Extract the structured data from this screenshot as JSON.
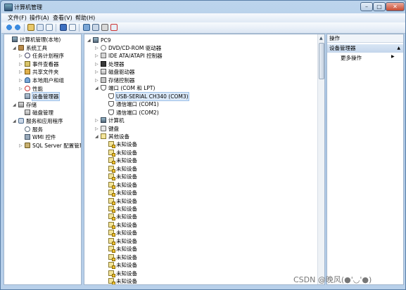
{
  "window": {
    "title": "计算机管理"
  },
  "menu": [
    "文件(F)",
    "操作(A)",
    "查看(V)",
    "帮助(H)"
  ],
  "left_tree": [
    {
      "label": "计算机管理(本地)",
      "depth": 0,
      "twisty": "",
      "icon": "computer-management-icon",
      "cls": "i-comp"
    },
    {
      "label": "系统工具",
      "depth": 1,
      "twisty": "◢",
      "icon": "system-tools-icon",
      "cls": "i-tools"
    },
    {
      "label": "任务计划程序",
      "depth": 2,
      "twisty": "▷",
      "icon": "task-scheduler-icon",
      "cls": "i-clock"
    },
    {
      "label": "事件查看器",
      "depth": 2,
      "twisty": "▷",
      "icon": "event-viewer-icon",
      "cls": "i-event"
    },
    {
      "label": "共享文件夹",
      "depth": 2,
      "twisty": "▷",
      "icon": "shared-folders-icon",
      "cls": "i-share"
    },
    {
      "label": "本地用户和组",
      "depth": 2,
      "twisty": "▷",
      "icon": "local-users-icon",
      "cls": "i-users"
    },
    {
      "label": "性能",
      "depth": 2,
      "twisty": "▷",
      "icon": "performance-icon",
      "cls": "i-perf"
    },
    {
      "label": "设备管理器",
      "depth": 2,
      "twisty": "",
      "icon": "device-manager-icon",
      "cls": "i-devmgr",
      "selected": true
    },
    {
      "label": "存储",
      "depth": 1,
      "twisty": "◢",
      "icon": "storage-icon",
      "cls": "i-store"
    },
    {
      "label": "磁盘管理",
      "depth": 2,
      "twisty": "",
      "icon": "disk-management-icon",
      "cls": "i-disk"
    },
    {
      "label": "服务和应用程序",
      "depth": 1,
      "twisty": "◢",
      "icon": "services-apps-icon",
      "cls": "i-svc"
    },
    {
      "label": "服务",
      "depth": 2,
      "twisty": "",
      "icon": "services-icon",
      "cls": "i-gear"
    },
    {
      "label": "WMI 控件",
      "depth": 2,
      "twisty": "",
      "icon": "wmi-icon",
      "cls": "i-wmi"
    },
    {
      "label": "SQL Server 配置管理器",
      "depth": 2,
      "twisty": "▷",
      "icon": "sql-server-icon",
      "cls": "i-sql"
    }
  ],
  "device_tree": {
    "root": "PC9",
    "items": [
      {
        "label": "DVD/CD-ROM 驱动器",
        "depth": 1,
        "twisty": "▷",
        "icon": "dvd-drive-icon",
        "cls": "i-cd"
      },
      {
        "label": "IDE ATA/ATAPI 控制器",
        "depth": 1,
        "twisty": "▷",
        "icon": "ide-controller-icon",
        "cls": "i-ide"
      },
      {
        "label": "处理器",
        "depth": 1,
        "twisty": "▷",
        "icon": "processor-icon",
        "cls": "i-cpu"
      },
      {
        "label": "磁盘驱动器",
        "depth": 1,
        "twisty": "▷",
        "icon": "disk-drive-icon",
        "cls": "i-hd"
      },
      {
        "label": "存储控制器",
        "depth": 1,
        "twisty": "▷",
        "icon": "storage-controller-icon",
        "cls": "i-storctl"
      },
      {
        "label": "端口 (COM 和 LPT)",
        "depth": 1,
        "twisty": "◢",
        "icon": "ports-icon",
        "cls": "i-port"
      },
      {
        "label": "USB-SERIAL CH340 (COM3)",
        "depth": 2,
        "twisty": "",
        "icon": "port-device-icon",
        "cls": "i-port",
        "selected": true
      },
      {
        "label": "通信端口 (COM1)",
        "depth": 2,
        "twisty": "",
        "icon": "port-device-icon",
        "cls": "i-port"
      },
      {
        "label": "通信端口 (COM2)",
        "depth": 2,
        "twisty": "",
        "icon": "port-device-icon",
        "cls": "i-port"
      },
      {
        "label": "计算机",
        "depth": 1,
        "twisty": "▷",
        "icon": "computer-icon",
        "cls": "i-comp"
      },
      {
        "label": "键盘",
        "depth": 1,
        "twisty": "▷",
        "icon": "keyboard-icon",
        "cls": "i-kbd"
      },
      {
        "label": "其他设备",
        "depth": 1,
        "twisty": "◢",
        "icon": "other-devices-icon",
        "cls": "i-unk"
      },
      {
        "label": "未知设备",
        "depth": 2,
        "twisty": "",
        "icon": "unknown-device-icon",
        "cls": "i-unk",
        "warn": true
      },
      {
        "label": "未知设备",
        "depth": 2,
        "twisty": "",
        "icon": "unknown-device-icon",
        "cls": "i-unk",
        "warn": true
      },
      {
        "label": "未知设备",
        "depth": 2,
        "twisty": "",
        "icon": "unknown-device-icon",
        "cls": "i-unk",
        "warn": true
      },
      {
        "label": "未知设备",
        "depth": 2,
        "twisty": "",
        "icon": "unknown-device-icon",
        "cls": "i-unk",
        "warn": true
      },
      {
        "label": "未知设备",
        "depth": 2,
        "twisty": "",
        "icon": "unknown-device-icon",
        "cls": "i-unk",
        "warn": true
      },
      {
        "label": "未知设备",
        "depth": 2,
        "twisty": "",
        "icon": "unknown-device-icon",
        "cls": "i-unk",
        "warn": true
      },
      {
        "label": "未知设备",
        "depth": 2,
        "twisty": "",
        "icon": "unknown-device-icon",
        "cls": "i-unk",
        "warn": true
      },
      {
        "label": "未知设备",
        "depth": 2,
        "twisty": "",
        "icon": "unknown-device-icon",
        "cls": "i-unk",
        "warn": true
      },
      {
        "label": "未知设备",
        "depth": 2,
        "twisty": "",
        "icon": "unknown-device-icon",
        "cls": "i-unk",
        "warn": true
      },
      {
        "label": "未知设备",
        "depth": 2,
        "twisty": "",
        "icon": "unknown-device-icon",
        "cls": "i-unk",
        "warn": true
      },
      {
        "label": "未知设备",
        "depth": 2,
        "twisty": "",
        "icon": "unknown-device-icon",
        "cls": "i-unk",
        "warn": true
      },
      {
        "label": "未知设备",
        "depth": 2,
        "twisty": "",
        "icon": "unknown-device-icon",
        "cls": "i-unk",
        "warn": true
      },
      {
        "label": "未知设备",
        "depth": 2,
        "twisty": "",
        "icon": "unknown-device-icon",
        "cls": "i-unk",
        "warn": true
      },
      {
        "label": "未知设备",
        "depth": 2,
        "twisty": "",
        "icon": "unknown-device-icon",
        "cls": "i-unk",
        "warn": true
      },
      {
        "label": "未知设备",
        "depth": 2,
        "twisty": "",
        "icon": "unknown-device-icon",
        "cls": "i-unk",
        "warn": true
      },
      {
        "label": "未知设备",
        "depth": 2,
        "twisty": "",
        "icon": "unknown-device-icon",
        "cls": "i-unk",
        "warn": true
      },
      {
        "label": "未知设备",
        "depth": 2,
        "twisty": "",
        "icon": "unknown-device-icon",
        "cls": "i-unk",
        "warn": true
      },
      {
        "label": "未知设备",
        "depth": 2,
        "twisty": "",
        "icon": "unknown-device-icon",
        "cls": "i-unk",
        "warn": true
      }
    ]
  },
  "actions": {
    "header": "操作",
    "section": "设备管理器",
    "more": "更多操作"
  },
  "watermark": "CSDN @晚风(●'◡'●)"
}
